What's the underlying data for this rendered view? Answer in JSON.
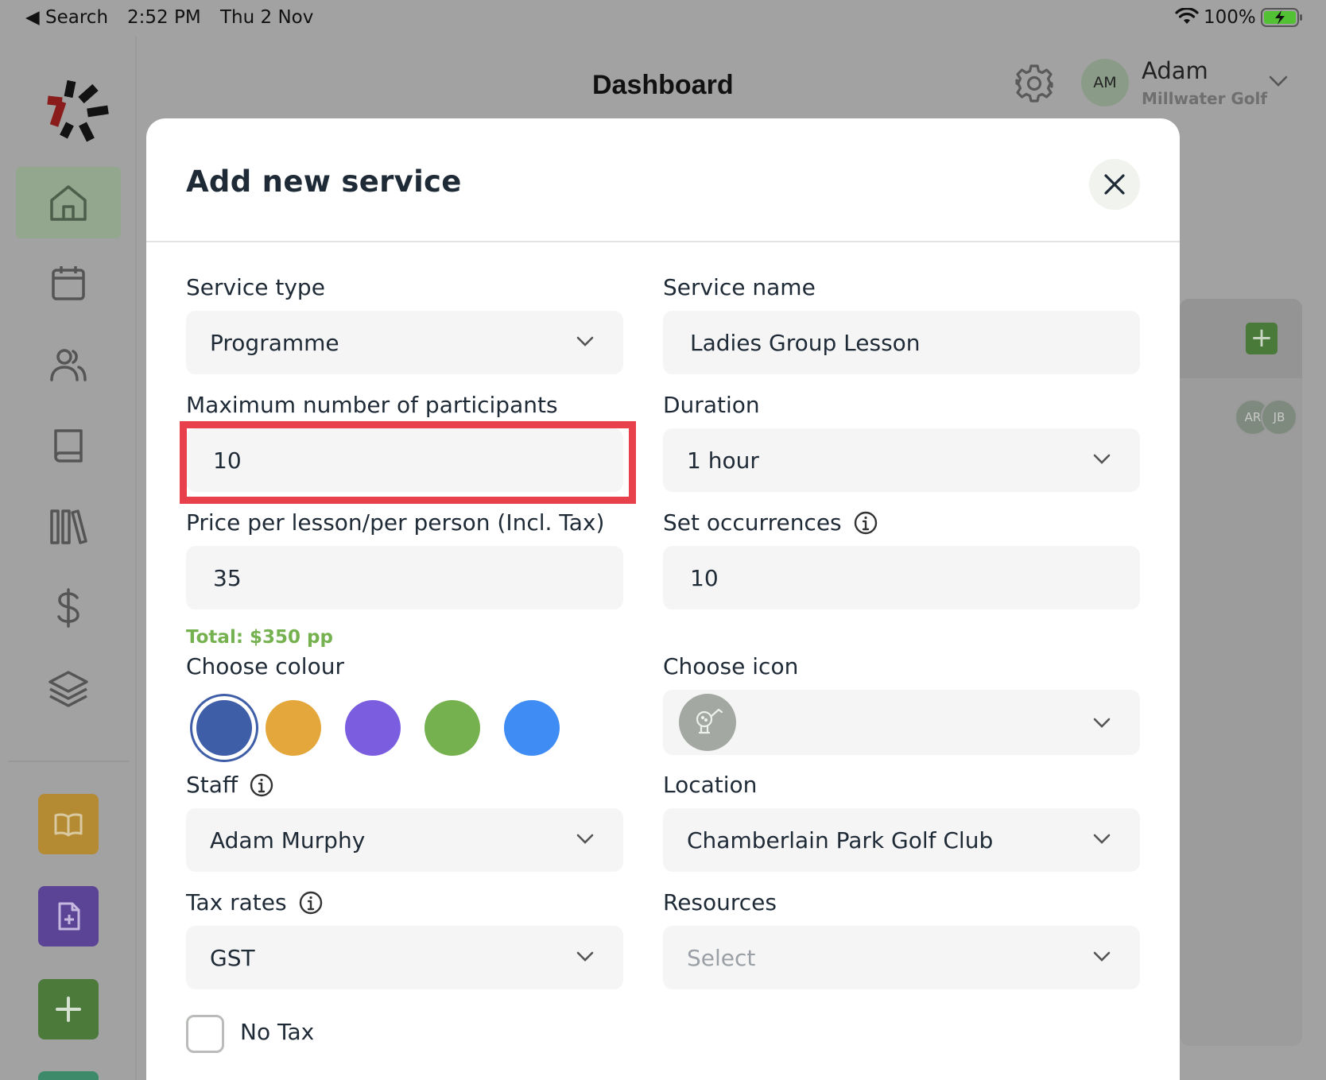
{
  "status_bar": {
    "back_label": "◀ Search",
    "time": "2:52 PM",
    "date": "Thu 2 Nov",
    "battery_pct": "100%"
  },
  "header": {
    "title": "Dashboard",
    "user_initials": "AM",
    "user_name": "Adam",
    "user_org": "Millwater Golf"
  },
  "sidebar": {
    "items": [
      {
        "icon": "home-icon",
        "active": true
      },
      {
        "icon": "calendar-icon",
        "active": false
      },
      {
        "icon": "users-icon",
        "active": false
      },
      {
        "icon": "book-icon",
        "active": false
      },
      {
        "icon": "library-icon",
        "active": false
      },
      {
        "icon": "dollar-icon",
        "active": false
      },
      {
        "icon": "layers-icon",
        "active": false
      }
    ],
    "quick_actions": [
      {
        "icon": "open-book-icon",
        "color": "#b48a33"
      },
      {
        "icon": "file-plus-icon",
        "color": "#5b4395"
      },
      {
        "icon": "plus-icon",
        "color": "#4b7a3a"
      }
    ]
  },
  "background": {
    "avatars": [
      "AR",
      "JB"
    ]
  },
  "modal": {
    "title": "Add new service",
    "fields": {
      "service_type": {
        "label": "Service type",
        "value": "Programme"
      },
      "service_name": {
        "label": "Service name",
        "value": "Ladies Group Lesson"
      },
      "max_participants": {
        "label": "Maximum number of participants",
        "value": "10"
      },
      "duration": {
        "label": "Duration",
        "value": "1 hour"
      },
      "price": {
        "label": "Price per lesson/per person (Incl. Tax)",
        "value": "35"
      },
      "occurrences": {
        "label": "Set occurrences",
        "value": "10"
      },
      "colour": {
        "label": "Choose colour"
      },
      "icon": {
        "label": "Choose icon"
      },
      "staff": {
        "label": "Staff",
        "value": "Adam Murphy"
      },
      "location": {
        "label": "Location",
        "value": "Chamberlain Park Golf Club"
      },
      "tax_rates": {
        "label": "Tax rates",
        "value": "GST"
      },
      "resources": {
        "label": "Resources",
        "placeholder": "Select"
      }
    },
    "total": "Total: $350 pp",
    "colours": [
      "#3f5ea8",
      "#e3a73c",
      "#7b5ee0",
      "#76b150",
      "#3f8cf5"
    ],
    "selected_colour": "#3f5ea8",
    "no_tax_label": "No Tax",
    "no_tax_checked": false
  }
}
